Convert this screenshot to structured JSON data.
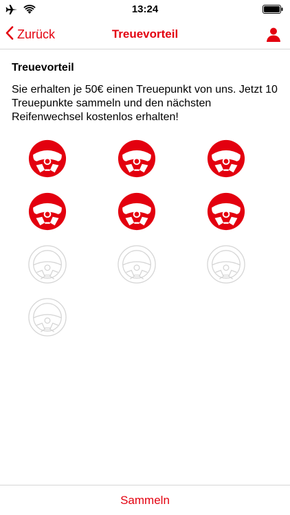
{
  "status_bar": {
    "time": "13:24",
    "icons": [
      "airplane-icon",
      "wifi-icon",
      "battery-icon"
    ]
  },
  "nav": {
    "back_label": "Zurück",
    "title": "Treuevorteil",
    "profile_icon": "person-icon"
  },
  "content": {
    "section_title": "Treuevorteil",
    "description": "Sie erhalten je 50€ einen Treuepunkt von uns. Jetzt 10 Treuepunkte sammeln und den nächsten Reifenwechsel kostenlos erhalten!"
  },
  "loyalty": {
    "total_slots": 10,
    "collected": 6,
    "icon": "steering-wheel-icon"
  },
  "footer": {
    "collect_label": "Sammeln"
  },
  "colors": {
    "accent": "#e3000f",
    "inactive": "#d4d4d4"
  }
}
